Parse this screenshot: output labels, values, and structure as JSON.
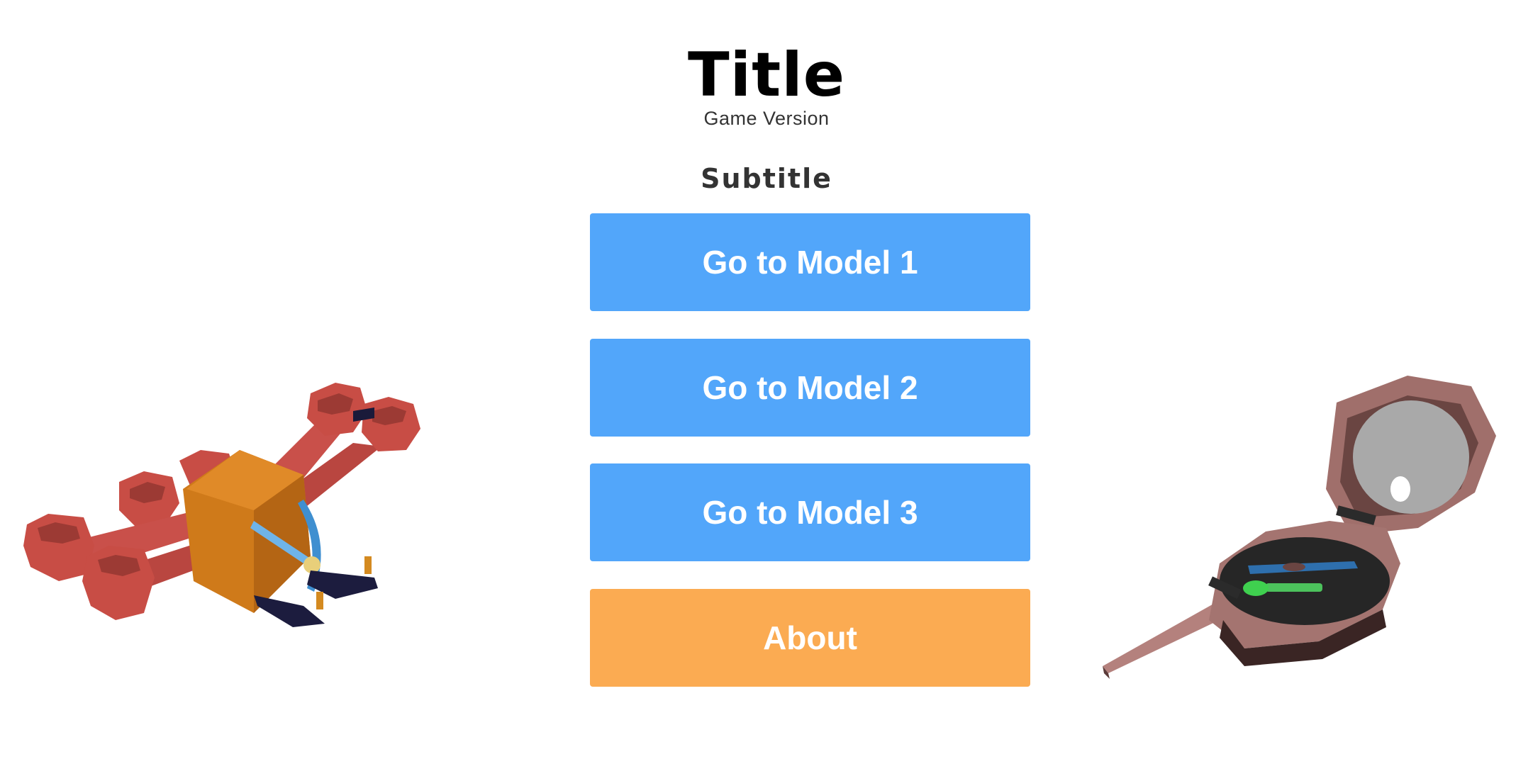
{
  "header": {
    "title": "Title",
    "version": "Game Version",
    "subtitle": "Subtitle"
  },
  "menu": {
    "buttons": [
      {
        "label": "Go to Model 1",
        "color": "#52a6fa"
      },
      {
        "label": "Go to Model 2",
        "color": "#52a6fa"
      },
      {
        "label": "Go to Model 3",
        "color": "#52a6fa"
      },
      {
        "label": "About",
        "color": "#fbab52"
      }
    ]
  },
  "models": {
    "left": {
      "icon": "low-poly-vehicle-model"
    },
    "right": {
      "icon": "compass-model"
    }
  },
  "colors": {
    "background": "#ffffff",
    "primary_button": "#52a6fa",
    "secondary_button": "#fbab52",
    "button_text": "#ffffff"
  }
}
